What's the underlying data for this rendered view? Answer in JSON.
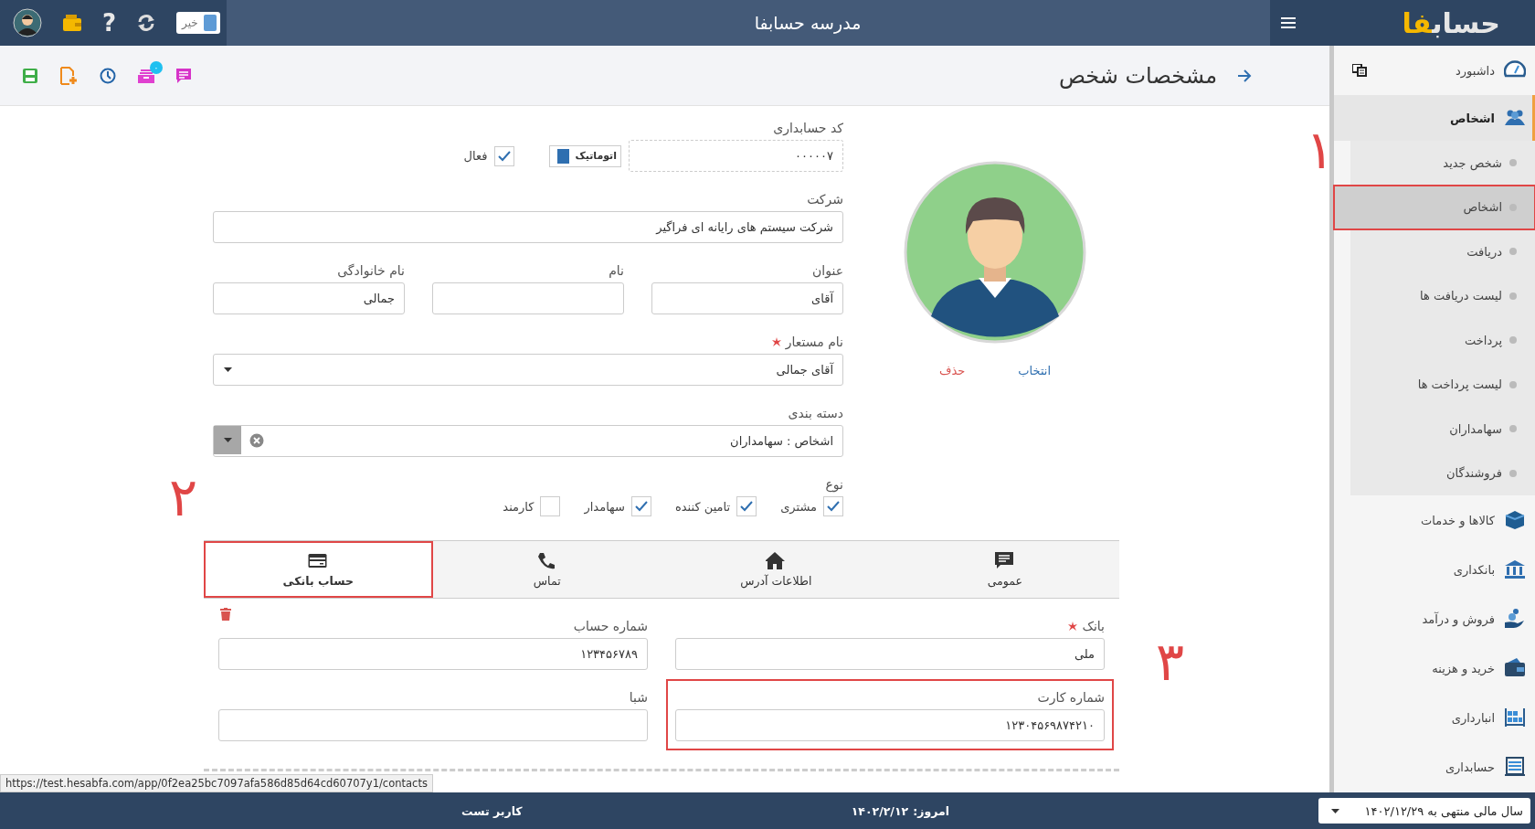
{
  "top_bar": {
    "title": "مدرسه حسابفا",
    "logo": {
      "main": "حساب",
      "accent": "فا"
    },
    "help_glyph": "?",
    "toggle": {
      "label": "خیر",
      "on": true
    }
  },
  "toolbar": {
    "badge": "۰"
  },
  "page_title": "مشخصات شخص",
  "sidebar": {
    "items": [
      {
        "label": "داشبورد",
        "selected": false
      },
      {
        "label": "اشخاص",
        "selected": true,
        "children": [
          {
            "label": "شخص جدید",
            "selected": false,
            "annotated": false
          },
          {
            "label": "اشخاص",
            "selected": true,
            "annotated": true
          },
          {
            "label": "دریافت",
            "selected": false,
            "annotated": false
          },
          {
            "label": "لیست دریافت ها",
            "selected": false,
            "annotated": false
          },
          {
            "label": "پرداخت",
            "selected": false,
            "annotated": false
          },
          {
            "label": "لیست پرداخت ها",
            "selected": false,
            "annotated": false
          },
          {
            "label": "سهامداران",
            "selected": false,
            "annotated": false
          },
          {
            "label": "فروشندگان",
            "selected": false,
            "annotated": false
          }
        ]
      },
      {
        "label": "کالاها و خدمات",
        "selected": false
      },
      {
        "label": "بانکداری",
        "selected": false
      },
      {
        "label": "فروش و درآمد",
        "selected": false
      },
      {
        "label": "خرید و هزینه",
        "selected": false
      },
      {
        "label": "انبارداری",
        "selected": false
      },
      {
        "label": "حسابداری",
        "selected": false
      }
    ]
  },
  "form": {
    "accounting_code": {
      "label": "کد حسابداری",
      "value": "۰۰۰۰۰۷",
      "auto_label": "اتوماتیک",
      "auto_on": true
    },
    "active": {
      "label": "فعال",
      "checked": true
    },
    "company": {
      "label": "شرکت",
      "value": "شرکت سیستم های رایانه ای فراگیر"
    },
    "name_fields": [
      {
        "label": "عنوان",
        "value": "آقای"
      },
      {
        "label": "نام"
      },
      {
        "label": "نام خانوادگی",
        "value": "جمالی"
      }
    ],
    "nickname": {
      "label": "نام مستعار",
      "required": true,
      "value": "آقای جمالی"
    },
    "category": {
      "label": "دسته بندی",
      "value": "اشخاص : سهامداران"
    },
    "type": {
      "label": "نوع",
      "options": [
        {
          "label": "مشتری",
          "checked": true
        },
        {
          "label": "تامین کننده",
          "checked": true
        },
        {
          "label": "سهامدار",
          "checked": true
        },
        {
          "label": "کارمند",
          "checked": false
        }
      ]
    },
    "avatar": {
      "choose": "انتخاب",
      "delete": "حذف"
    }
  },
  "tabs": [
    {
      "label": "عمومی",
      "selected": false,
      "annotated": false
    },
    {
      "label": "اطلاعات آدرس",
      "selected": false,
      "annotated": false
    },
    {
      "label": "تماس",
      "selected": false,
      "annotated": false
    },
    {
      "label": "حساب بانکی",
      "selected": true,
      "annotated": true
    }
  ],
  "bank_account": {
    "fields": [
      {
        "label": "بانک",
        "required": true,
        "value": "ملی",
        "annotated": false
      },
      {
        "label": "شماره حساب",
        "required": false,
        "value": "۱۲۳۴۵۶۷۸۹",
        "annotated": false
      },
      {
        "label": "شماره کارت",
        "required": false,
        "value": "۱۲۳۰۴۵۶۹۸۷۴۲۱۰",
        "annotated": true
      },
      {
        "label": "شبا",
        "required": false,
        "annotated": false
      }
    ]
  },
  "annotations": [
    {
      "label": "۱"
    },
    {
      "label": "۲"
    },
    {
      "label": "۳"
    }
  ],
  "footer": {
    "user": "کاربر تست",
    "today_label": "امروز:",
    "today": "۱۴۰۲/۲/۱۲",
    "fiscal_year": "سال مالی منتهی به ۱۴۰۲/۱۲/۲۹"
  },
  "status_url": "https://test.hesabfa.com/app/0f2ea25bc7097afa586d85d64cd60707y1/contacts"
}
